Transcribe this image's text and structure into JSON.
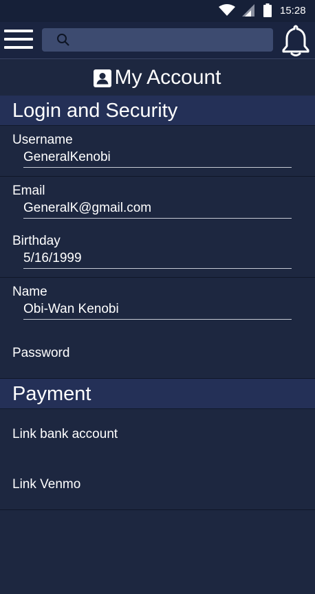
{
  "status_bar": {
    "time": "15:28"
  },
  "search": {
    "placeholder": ""
  },
  "header": {
    "title": "My Account"
  },
  "sections": {
    "login": {
      "title": "Login and Security",
      "fields": [
        {
          "label": "Username",
          "value": "GeneralKenobi"
        },
        {
          "label": "Email",
          "value": "GeneralK@gmail.com"
        },
        {
          "label": "Birthday",
          "value": "5/16/1999"
        },
        {
          "label": "Name",
          "value": "Obi-Wan Kenobi"
        }
      ],
      "password_label": "Password"
    },
    "payment": {
      "title": "Payment",
      "items": [
        {
          "label": "Link bank account"
        },
        {
          "label": "Link Venmo"
        }
      ]
    }
  },
  "colors": {
    "background": "#1d2740",
    "section_header": "#243057",
    "search_field": "#3d4b70"
  }
}
